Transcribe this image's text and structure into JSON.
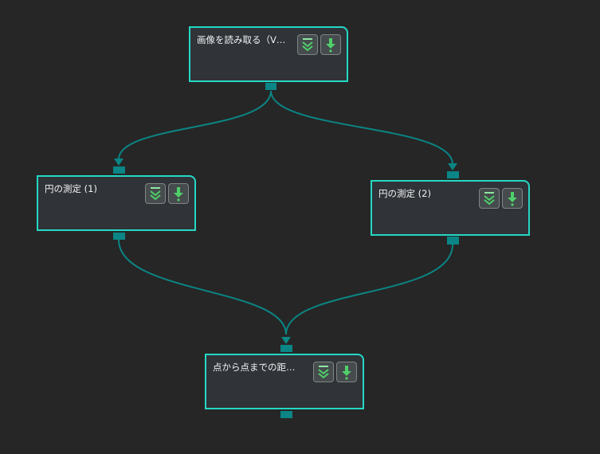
{
  "nodes": [
    {
      "title": "画像を読み取る（V…",
      "expand_icon": "double-chevron-down-icon",
      "run_icon": "arrow-down-icon"
    },
    {
      "title": "円の測定 (1)",
      "expand_icon": "double-chevron-down-icon",
      "run_icon": "arrow-down-icon"
    },
    {
      "title": "円の測定 (2)",
      "expand_icon": "double-chevron-down-icon",
      "run_icon": "arrow-down-icon"
    },
    {
      "title": "点から点までの距…",
      "expand_icon": "double-chevron-down-icon",
      "run_icon": "arrow-down-icon"
    }
  ],
  "colors": {
    "background": "#262626",
    "node_fill": "#303338",
    "node_border": "#24d8c4",
    "connector": "#0b8585",
    "icon_green": "#4fd06a"
  }
}
